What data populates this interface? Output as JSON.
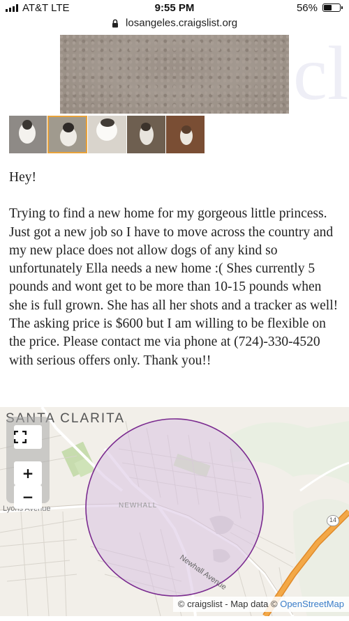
{
  "status_bar": {
    "carrier": "AT&T  LTE",
    "time": "9:55 PM",
    "battery_percent_label": "56%",
    "battery_level": 0.56
  },
  "browser": {
    "url": "losangeles.craigslist.org"
  },
  "gallery": {
    "thumbnail_count": 5,
    "selected_index": 1
  },
  "post": {
    "greeting": "Hey!",
    "body": "Trying to find a new home for my gorgeous little princess. Just got a new job so I have to move across the country and my new place does not allow dogs of any kind so unfortunately Ella needs a new home :( Shes currently 5 pounds and wont get to be more than 10-15 pounds when she is full grown. She has all her shots and a tracker as well! The asking price is $600 but I am willing to be flexible on the price. Please contact me via phone at (724)-330-4520 with serious offers only. Thank you!!"
  },
  "map": {
    "city_label": "SANTA CLARITA",
    "area_label": "NEWHALL",
    "street_label_1": "Lyons Avenue",
    "street_label_2": "Newhall Avenue",
    "route_number": "14",
    "zoom_in_label": "+",
    "zoom_out_label": "−",
    "attribution_prefix": "© craigslist - Map data © ",
    "attribution_link": "OpenStreetMap"
  },
  "colors": {
    "circle_stroke": "#7a2a8f",
    "circle_fill": "#e4d3ea",
    "highway": "#f0a03c",
    "selected_thumb_border": "#e8a23a",
    "link": "#3a7dc9"
  }
}
